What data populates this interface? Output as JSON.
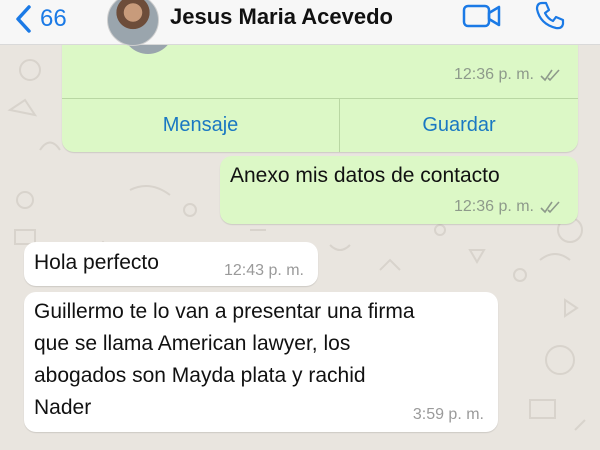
{
  "header": {
    "back_count": "66",
    "contact_name": "Jesus Maria Acevedo"
  },
  "contact_card": {
    "time": "12:36 p. m.",
    "buttons": {
      "message": "Mensaje",
      "save": "Guardar"
    }
  },
  "messages": [
    {
      "direction": "outgoing",
      "text": "Anexo mis datos de contacto",
      "time": "12:36 p. m."
    },
    {
      "direction": "incoming",
      "text": "Hola perfecto",
      "time": "12:43 p. m."
    },
    {
      "direction": "incoming",
      "lines": [
        "Guillermo te lo van a presentar una firma",
        "que se llama American lawyer, los",
        "abogados son Mayda plata y rachid",
        "Nader"
      ],
      "time": "3:59 p. m."
    }
  ],
  "colors": {
    "accent": "#1b7ae6",
    "outgoing_bubble": "#dcf8c6",
    "incoming_bubble": "#ffffff",
    "wallpaper": "#e9e5df",
    "read_ticks": "#8e9a8b"
  },
  "icons": {
    "back": "chevron-left-icon",
    "video": "video-camera-icon",
    "call": "phone-icon",
    "read": "double-check-icon"
  }
}
